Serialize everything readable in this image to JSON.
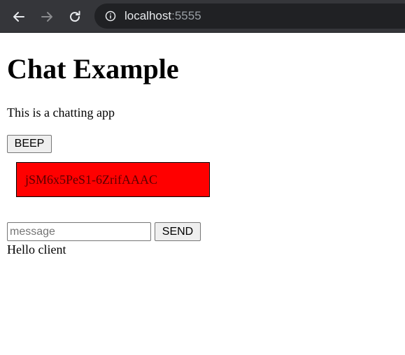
{
  "browser": {
    "url_host": "localhost",
    "url_port": ":5555",
    "back_icon": "arrow-left-icon",
    "forward_icon": "arrow-right-icon",
    "reload_icon": "reload-icon",
    "info_icon": "info-circle-icon"
  },
  "page": {
    "title": "Chat Example",
    "subtitle": "This is a chatting app",
    "beep_label": "BEEP",
    "client_id": "jSM6x5PeS1-6ZrifAAAC",
    "client_id_bg": "#ff0000",
    "message_placeholder": "message",
    "message_value": "",
    "send_label": "SEND",
    "messages": [
      "Hello client"
    ]
  }
}
